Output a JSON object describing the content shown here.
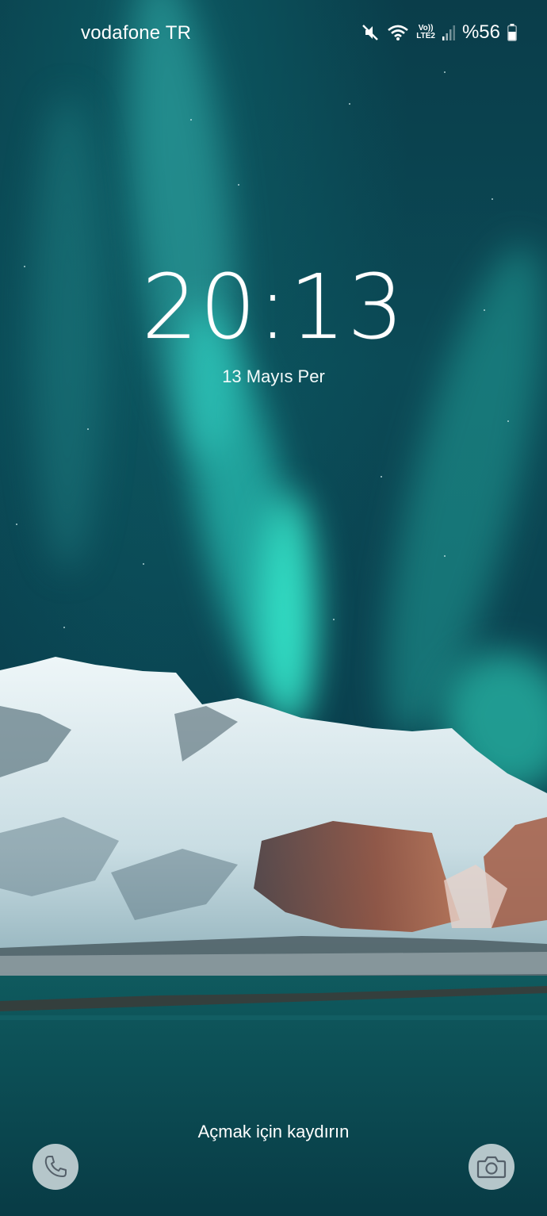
{
  "status_bar": {
    "carrier": "vodafone TR",
    "battery_percent": "%56",
    "network_label_top": "Vo))",
    "network_label_bottom": "LTE2",
    "icons": [
      "mute-icon",
      "wifi-icon",
      "volte-icon",
      "signal-icon",
      "battery-icon"
    ]
  },
  "lock_screen": {
    "time": "20:13",
    "date": "13 Mayıs Per",
    "swipe_hint": "Açmak için kaydırın"
  },
  "shortcuts": {
    "left_icon": "phone-icon",
    "right_icon": "camera-icon"
  },
  "colors": {
    "aurora": "#2fe0c9",
    "sky": "#0a4250",
    "water": "#0d4f55",
    "snow": "#e8f2f4",
    "rock": "#8a4a38"
  }
}
